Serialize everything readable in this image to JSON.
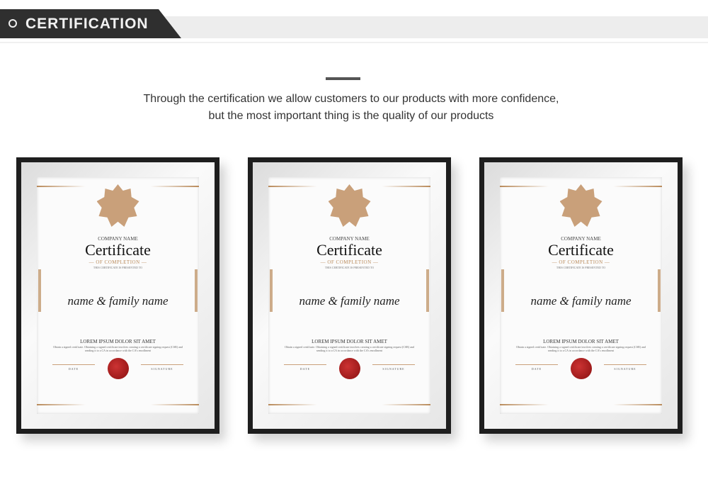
{
  "header": {
    "title": "CERTIFICATION"
  },
  "intro": {
    "line1": "Through the certification we allow customers to our products with more confidence,",
    "line2": "but the most important thing is the quality of our products"
  },
  "certificates": [
    {
      "company": "COMPANY NAME",
      "title": "Certificate",
      "subtitle": "— OF COMPLETION —",
      "presented": "THIS CERTIFICATE IS PRESENTED TO",
      "name": "name & family name",
      "heading": "LOREM IPSUM DOLOR SIT AMET",
      "body": "Obtain a signed certificate. Obtaining a signed certificate involves creating a certificate signing request (CSR) and sending it to a CA in accordance with the CA's enrollment",
      "date": "DATE",
      "signature": "SIGNATURE"
    },
    {
      "company": "COMPANY NAME",
      "title": "Certificate",
      "subtitle": "— OF COMPLETION —",
      "presented": "THIS CERTIFICATE IS PRESENTED TO",
      "name": "name & family name",
      "heading": "LOREM IPSUM DOLOR SIT AMET",
      "body": "Obtain a signed certificate. Obtaining a signed certificate involves creating a certificate signing request (CSR) and sending it to a CA in accordance with the CA's enrollment",
      "date": "DATE",
      "signature": "SIGNATURE"
    },
    {
      "company": "COMPANY NAME",
      "title": "Certificate",
      "subtitle": "— OF COMPLETION —",
      "presented": "THIS CERTIFICATE IS PRESENTED TO",
      "name": "name & family name",
      "heading": "LOREM IPSUM DOLOR SIT AMET",
      "body": "Obtain a signed certificate. Obtaining a signed certificate involves creating a certificate signing request (CSR) and sending it to a CA in accordance with the CA's enrollment",
      "date": "DATE",
      "signature": "SIGNATURE"
    }
  ]
}
